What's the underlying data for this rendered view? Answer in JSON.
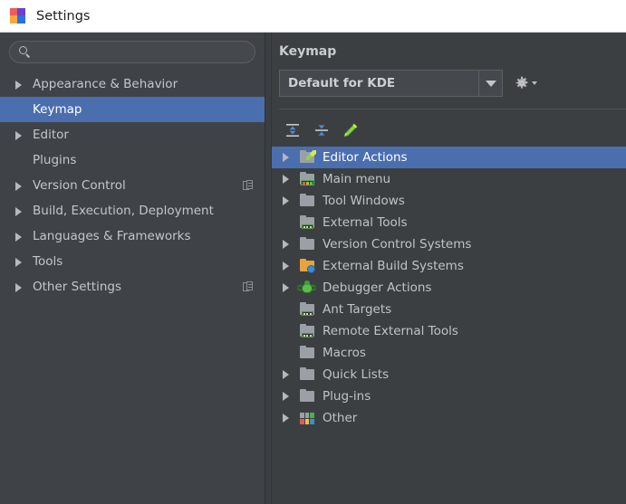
{
  "window": {
    "title": "Settings",
    "icon": "intellij-logo-icon"
  },
  "colors": {
    "titlebar_bg": "#ffffff",
    "sidebar_bg": "#3f4247",
    "panel_bg": "#3c3f41",
    "selection_blue": "#4b6eaf",
    "text": "#c0c3c8",
    "accent_green": "#8fd14f"
  },
  "sidebar": {
    "search": {
      "value": "",
      "placeholder": "",
      "icon": "search-icon"
    },
    "items": [
      {
        "label": "Appearance & Behavior",
        "expandable": true,
        "selected": false,
        "badge": false
      },
      {
        "label": "Keymap",
        "expandable": false,
        "selected": true,
        "badge": false
      },
      {
        "label": "Editor",
        "expandable": true,
        "selected": false,
        "badge": false
      },
      {
        "label": "Plugins",
        "expandable": false,
        "selected": false,
        "badge": false
      },
      {
        "label": "Version Control",
        "expandable": true,
        "selected": false,
        "badge": true
      },
      {
        "label": "Build, Execution, Deployment",
        "expandable": true,
        "selected": false,
        "badge": false
      },
      {
        "label": "Languages & Frameworks",
        "expandable": true,
        "selected": false,
        "badge": false
      },
      {
        "label": "Tools",
        "expandable": true,
        "selected": false,
        "badge": false
      },
      {
        "label": "Other Settings",
        "expandable": true,
        "selected": false,
        "badge": true
      }
    ]
  },
  "panel": {
    "title": "Keymap",
    "keymap_combo": {
      "value": "Default for KDE",
      "arrow_icon": "chevron-down-icon"
    },
    "gear": {
      "icon": "gear-icon",
      "caret_icon": "chevron-down-icon"
    },
    "toolbar": [
      {
        "name": "expand-all-button",
        "icon": "expand-all-icon",
        "tooltip": "Expand All"
      },
      {
        "name": "collapse-all-button",
        "icon": "collapse-all-icon",
        "tooltip": "Collapse All"
      },
      {
        "name": "edit-shortcut-button",
        "icon": "pencil-icon",
        "tooltip": "Edit Shortcut"
      }
    ],
    "tree": [
      {
        "label": "Editor Actions",
        "expandable": true,
        "selected": true,
        "icon": "folder-pencil-icon"
      },
      {
        "label": "Main menu",
        "expandable": true,
        "selected": false,
        "icon": "folder-menubar-icon"
      },
      {
        "label": "Tool Windows",
        "expandable": true,
        "selected": false,
        "icon": "folder-icon"
      },
      {
        "label": "External Tools",
        "expandable": false,
        "selected": false,
        "icon": "folder-tools-icon"
      },
      {
        "label": "Version Control Systems",
        "expandable": true,
        "selected": false,
        "icon": "folder-icon"
      },
      {
        "label": "External Build Systems",
        "expandable": true,
        "selected": false,
        "icon": "folder-gear-icon"
      },
      {
        "label": "Debugger Actions",
        "expandable": true,
        "selected": false,
        "icon": "bug-icon"
      },
      {
        "label": "Ant Targets",
        "expandable": false,
        "selected": false,
        "icon": "folder-tools-icon"
      },
      {
        "label": "Remote External Tools",
        "expandable": false,
        "selected": false,
        "icon": "folder-tools-icon"
      },
      {
        "label": "Macros",
        "expandable": false,
        "selected": false,
        "icon": "folder-icon"
      },
      {
        "label": "Quick Lists",
        "expandable": true,
        "selected": false,
        "icon": "folder-icon"
      },
      {
        "label": "Plug-ins",
        "expandable": true,
        "selected": false,
        "icon": "folder-icon"
      },
      {
        "label": "Other",
        "expandable": true,
        "selected": false,
        "icon": "grid-color-icon"
      }
    ]
  }
}
